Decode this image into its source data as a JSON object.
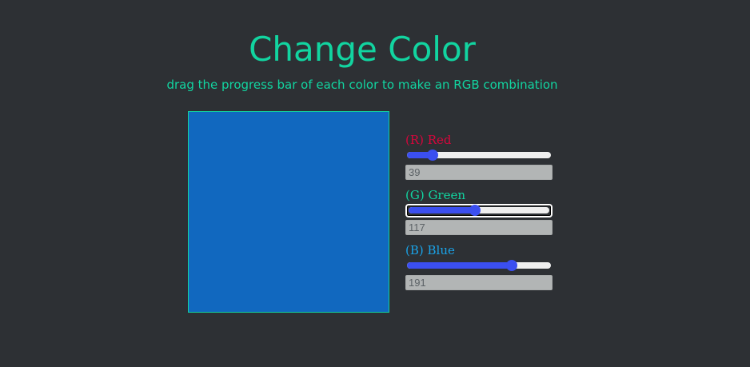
{
  "header": {
    "title": "Change Color",
    "subtitle": "drag the progress bar of each color to make an RGB combination"
  },
  "preview": {
    "color": "#1168bf"
  },
  "theme": {
    "background": "#2d3034",
    "accent": "#12d4a0",
    "slider_color": "#3b4ff0"
  },
  "channels": [
    {
      "label": "(R) Red",
      "value": "39",
      "fraction": 0.153,
      "color": "#d6063c",
      "focused": false
    },
    {
      "label": "(G) Green",
      "value": "117",
      "fraction": 0.459,
      "color": "#12d4a0",
      "focused": true
    },
    {
      "label": "(B) Blue",
      "value": "191",
      "fraction": 0.749,
      "color": "#1aa3e8",
      "focused": false
    }
  ]
}
